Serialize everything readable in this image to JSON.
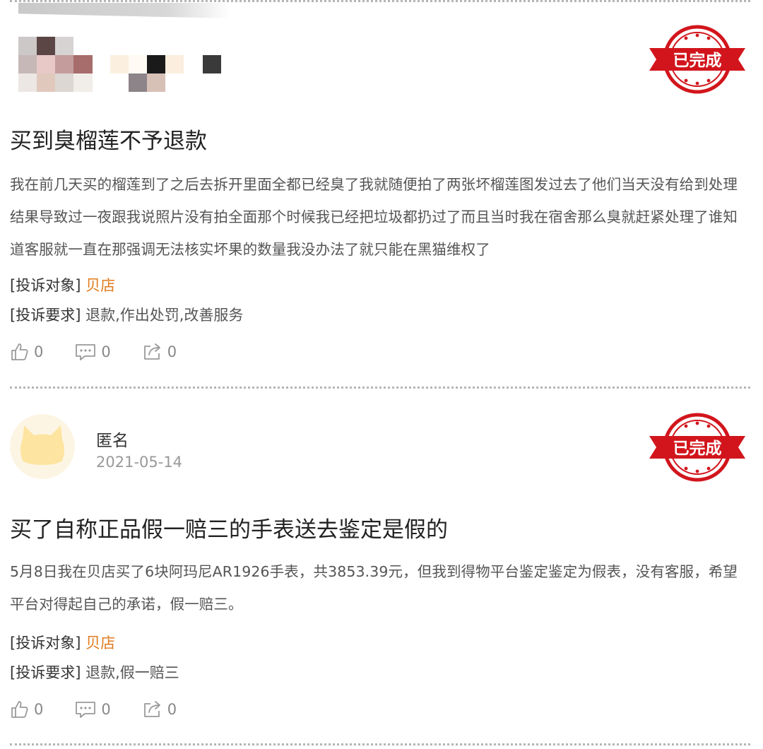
{
  "posts": [
    {
      "status_stamp": "已完成",
      "title": "买到臭榴莲不予退款",
      "content": "我在前几天买的榴莲到了之后去拆开里面全都已经臭了我就随便拍了两张坏榴莲图发过去了他们当天没有给到处理结果导致过一夜跟我说照片没有拍全面那个时候我已经把垃圾都扔过了而且当时我在宿舍那么臭就赶紧处理了谁知道客服就一直在那强调无法核实坏果的数量我没办法了就只能在黑猫维权了",
      "target_label": "[投诉对象]",
      "target_value": "贝店",
      "demand_label": "[投诉要求]",
      "demand_value": "退款,作出处罚,改善服务",
      "likes": "0",
      "comments": "0",
      "shares": "0"
    },
    {
      "user_name": "匿名",
      "date": "2021-05-14",
      "status_stamp": "已完成",
      "title": "买了自称正品假一赔三的手表送去鉴定是假的",
      "content": "5月8日我在贝店买了6块阿玛尼AR1926手表，共3853.39元，但我到得物平台鉴定鉴定为假表，没有客服，希望平台对得起自己的承诺，假一赔三。",
      "target_label": "[投诉对象]",
      "target_value": "贝店",
      "demand_label": "[投诉要求]",
      "demand_value": "退款,假一赔三",
      "likes": "0",
      "comments": "0",
      "shares": "0"
    }
  ],
  "colors": {
    "stamp_red": "#d2151c",
    "target_orange": "#e07a1c",
    "icon_gray": "#9a9a9a"
  }
}
